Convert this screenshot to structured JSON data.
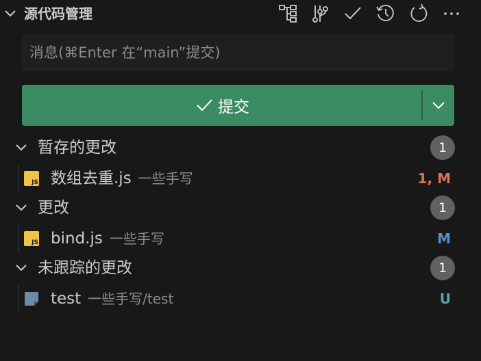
{
  "header": {
    "title": "源代码管理"
  },
  "toolbar": {
    "icons": [
      "tree-view-icon",
      "branch-graph-icon",
      "commit-check-icon",
      "history-icon",
      "refresh-icon",
      "more-actions-icon"
    ]
  },
  "commit": {
    "message_placeholder": "消息(⌘Enter 在“main”提交)",
    "message_value": "",
    "button_label": "提交",
    "accent_color": "#3c8c63"
  },
  "groups": [
    {
      "label": "暂存的更改",
      "count": "1",
      "files": [
        {
          "name": "数组去重.js",
          "path": "一些手写",
          "status": "1, M",
          "status_color": "#e0705a",
          "icon": "js-file-icon"
        }
      ]
    },
    {
      "label": "更改",
      "count": "1",
      "files": [
        {
          "name": "bind.js",
          "path": "一些手写",
          "status": "M",
          "status_color": "#5b8fc7",
          "icon": "js-file-icon"
        }
      ]
    },
    {
      "label": "未跟踪的更改",
      "count": "1",
      "files": [
        {
          "name": "test",
          "path": "一些手写/test",
          "status": "U",
          "status_color": "#58a6a6",
          "icon": "generic-file-icon"
        }
      ]
    }
  ]
}
